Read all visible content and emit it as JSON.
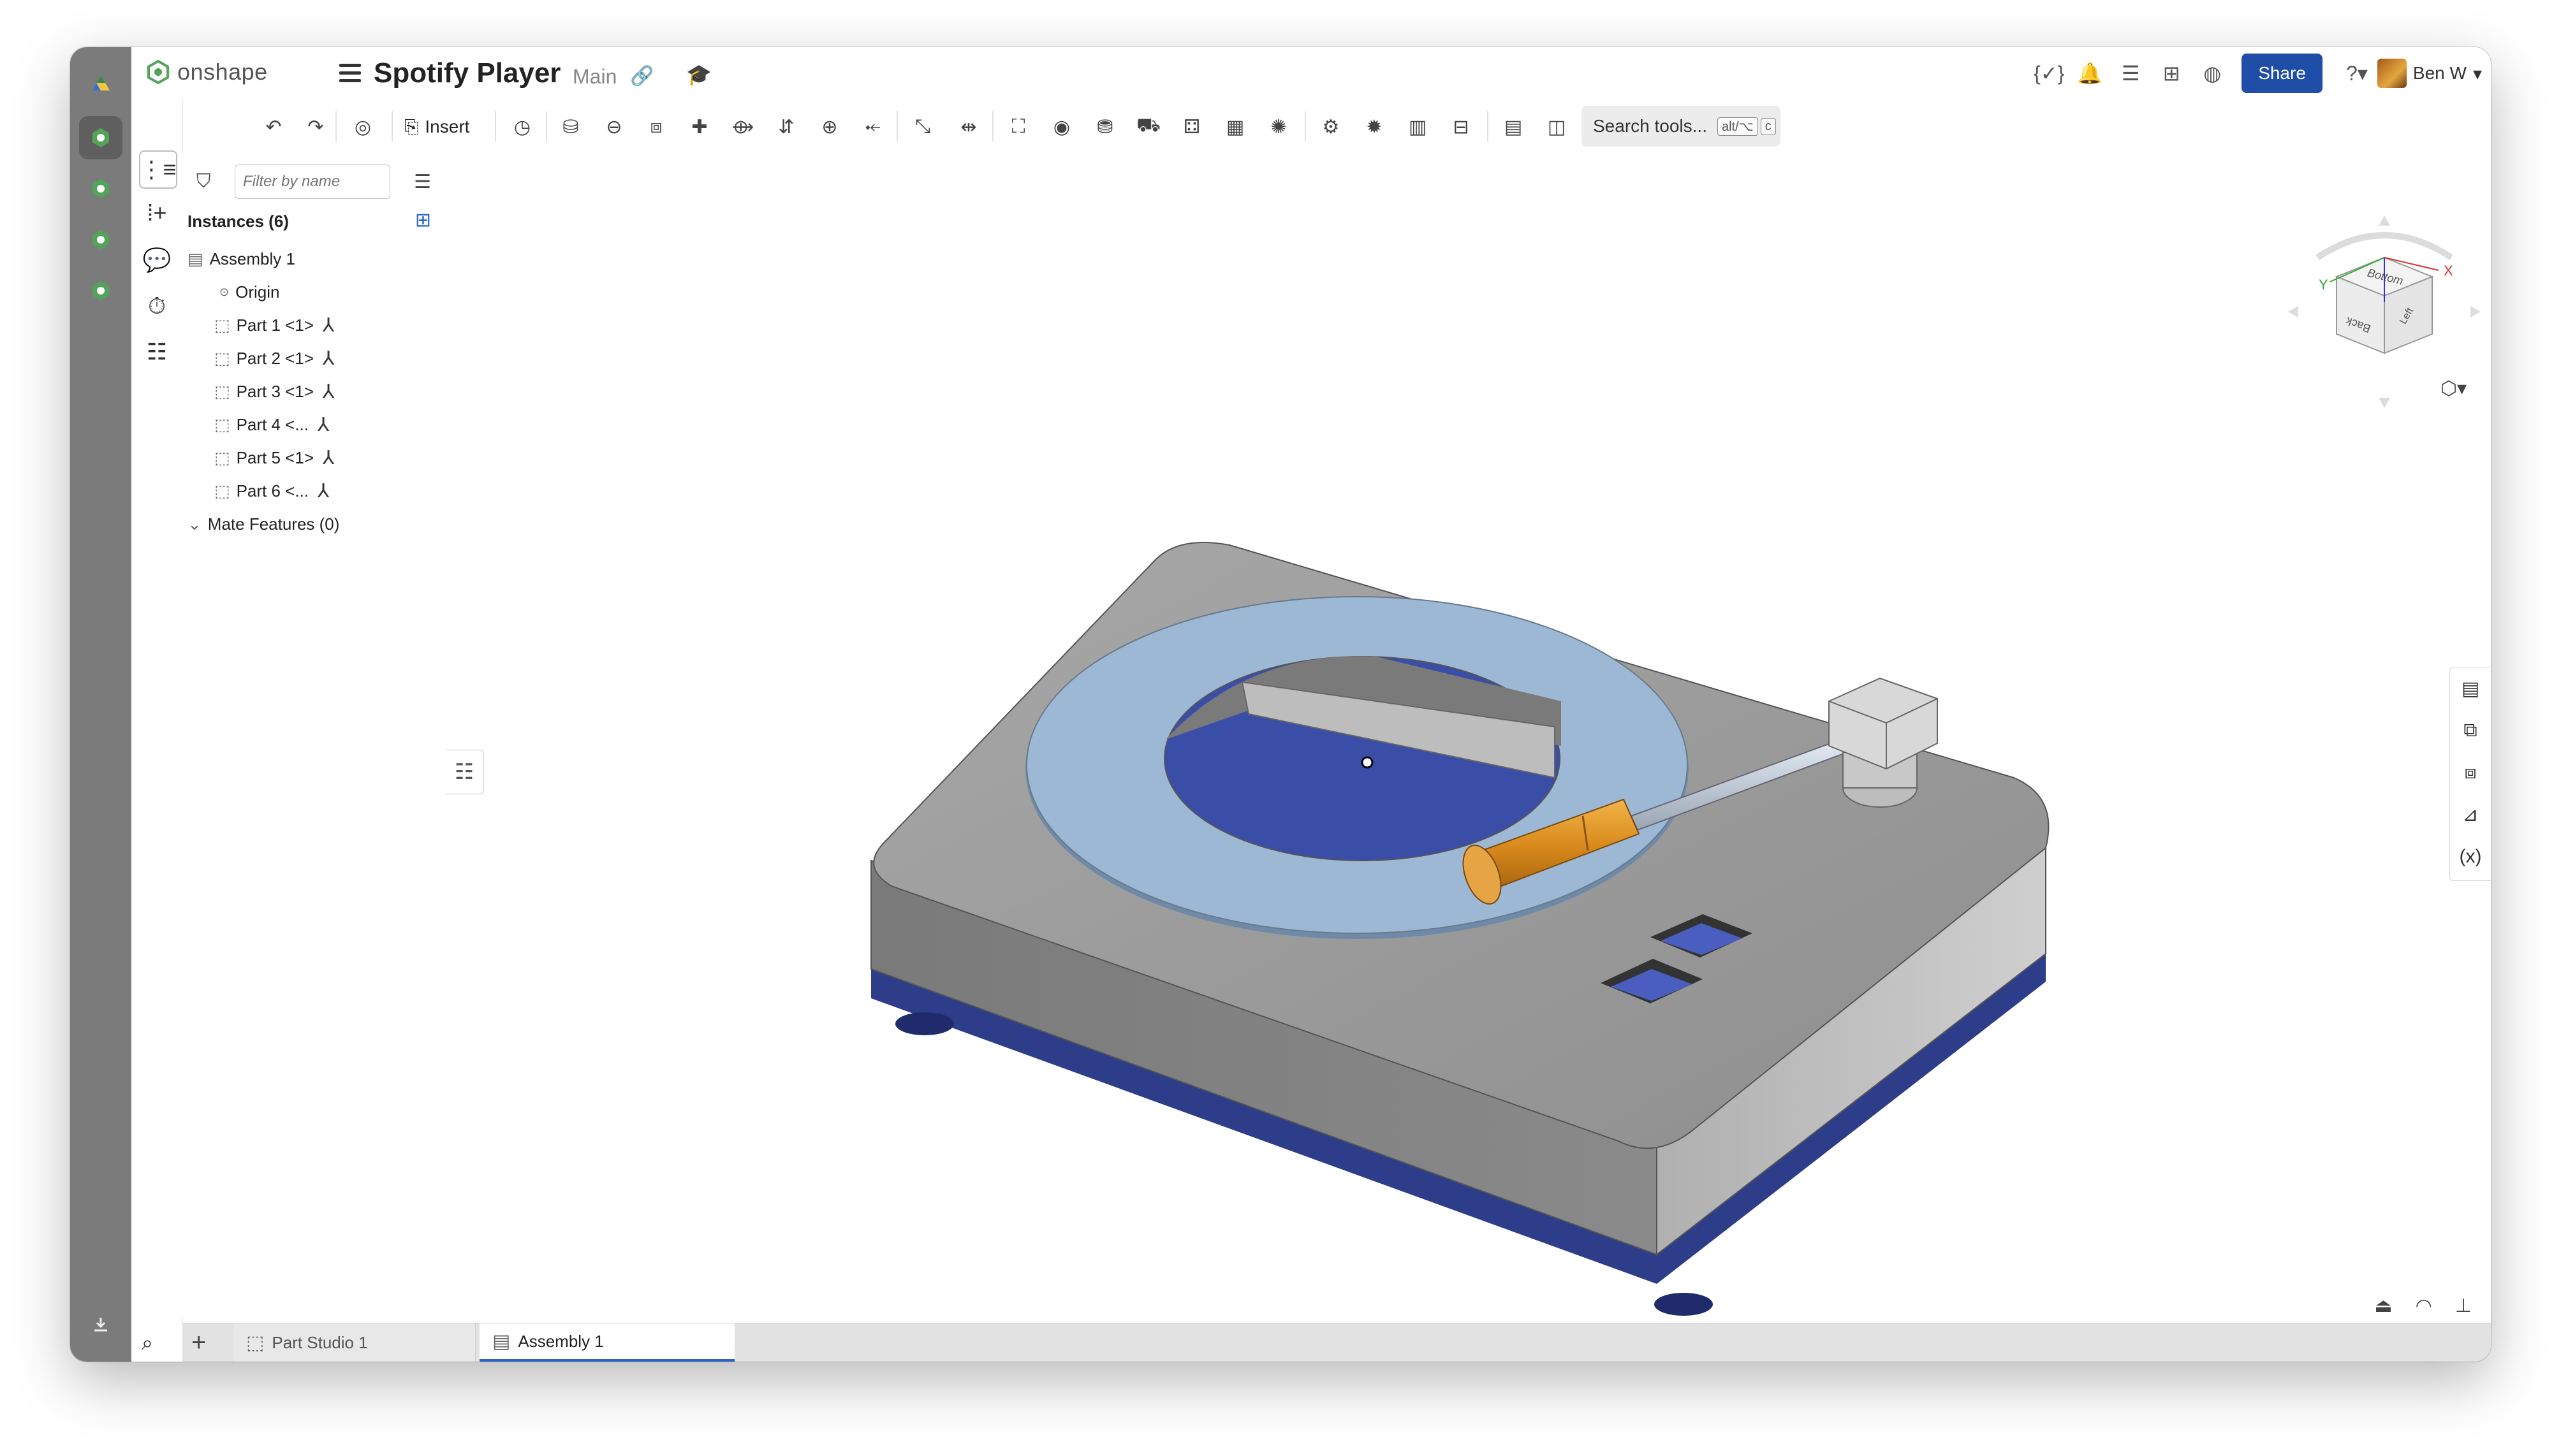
{
  "app": {
    "logo_text": "onshape",
    "document_title": "Spotify Player",
    "branch": "Main"
  },
  "topbar": {
    "share_label": "Share",
    "user_name": "Ben W"
  },
  "toolbar": {
    "insert_label": "Insert",
    "search_label": "Search tools...",
    "search_shortcut_1": "alt/⌥",
    "search_shortcut_2": "c"
  },
  "panel": {
    "filter_placeholder": "Filter by name",
    "instances_header": "Instances (6)",
    "tree": [
      {
        "label": "Assembly 1",
        "type": "assembly"
      },
      {
        "label": "Origin",
        "type": "origin"
      },
      {
        "label": "Part 1 <1>",
        "type": "part"
      },
      {
        "label": "Part 2 <1>",
        "type": "part"
      },
      {
        "label": "Part 3 <1>",
        "type": "part"
      },
      {
        "label": "Part 4 <...",
        "type": "part"
      },
      {
        "label": "Part 5 <1>",
        "type": "part"
      },
      {
        "label": "Part 6 <...",
        "type": "part"
      }
    ],
    "mate_features": "Mate Features (0)"
  },
  "viewcube": {
    "top_face": "Bottom",
    "front_face": "Back",
    "side_face": "Left",
    "axis_x": "X",
    "axis_y": "Y"
  },
  "tabs": [
    {
      "label": "Part Studio 1",
      "active": false
    },
    {
      "label": "Assembly 1",
      "active": true
    }
  ],
  "colors": {
    "body_gray": "#9a9a9a",
    "platter_light_blue": "#9cb8d4",
    "base_blue": "#2e3d8a",
    "handle_orange": "#d88a1c",
    "share_blue": "#1f4ea8"
  }
}
